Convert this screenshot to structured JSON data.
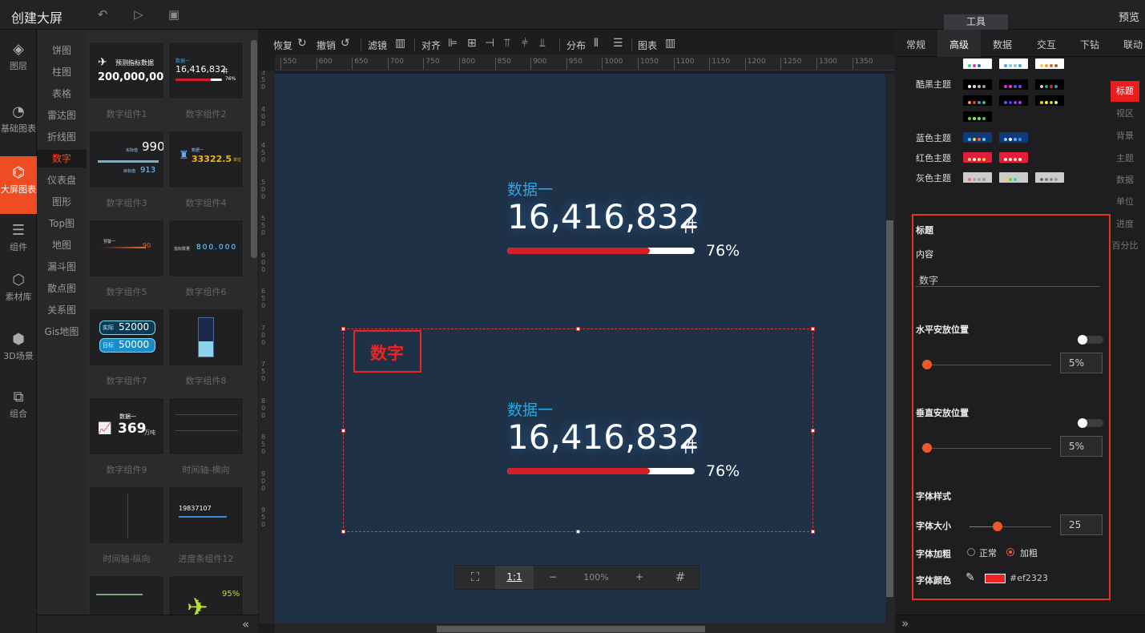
{
  "app": {
    "title": "创建大屏",
    "preview": "预览",
    "tools_tab": "工具"
  },
  "topbar_icons": [
    "undo-icon",
    "play-icon",
    "save-icon"
  ],
  "leftnav": [
    {
      "label": "图层",
      "icon": "layers-icon"
    },
    {
      "label": "基础图表",
      "icon": "pie-chart-icon"
    },
    {
      "label": "大屏图表",
      "icon": "monitor-chart-icon"
    },
    {
      "label": "组件",
      "icon": "sliders-icon"
    },
    {
      "label": "素材库",
      "icon": "hexagons-icon"
    },
    {
      "label": "3D场景",
      "icon": "cube-icon"
    },
    {
      "label": "组合",
      "icon": "group-icon"
    }
  ],
  "categories": [
    "饼图",
    "柱图",
    "表格",
    "雷达图",
    "折线图",
    "数字",
    "仪表盘",
    "图形",
    "Top图",
    "地图",
    "漏斗图",
    "散点图",
    "关系图",
    "Gis地图"
  ],
  "active_category": "数字",
  "components": [
    {
      "name": "数字组件1",
      "text1": "预测指标数据",
      "text2": "200,000,000"
    },
    {
      "name": "数字组件2",
      "text1": "数据一",
      "text2": "16,416,832",
      "text3": "件",
      "text4": "76%"
    },
    {
      "name": "数字组件3",
      "text1": "990",
      "text2": "913",
      "text3": "实际值",
      "text4": "目标值"
    },
    {
      "name": "数字组件4",
      "text1": "33322.5",
      "text2": "数据一",
      "text3": "单位"
    },
    {
      "name": "数字组件5",
      "text1": "90",
      "text2": "预警一"
    },
    {
      "name": "数字组件6",
      "text1": "800.000",
      "text2": "指标数量"
    },
    {
      "name": "数字组件7",
      "text1": "52000",
      "text2": "50000",
      "text3": "实际",
      "text4": "目标"
    },
    {
      "name": "数字组件8"
    },
    {
      "name": "数字组件9",
      "text1": "369",
      "text2": "万吨",
      "text3": "数据一"
    },
    {
      "name": "时间轴-横向"
    },
    {
      "name": "时间轴-纵向"
    },
    {
      "name": "进度条组件12",
      "text1": "19837107"
    },
    {
      "name": "",
      "text1": "95%"
    }
  ],
  "toolbar": {
    "redo": "恢复",
    "undo": "撤销",
    "filter": "滤镜",
    "align": "对齐",
    "distribute": "分布",
    "chart": "图表"
  },
  "ruler_h": [
    "550",
    "600",
    "650",
    "700",
    "750",
    "800",
    "850",
    "900",
    "950",
    "1000",
    "1050",
    "1100",
    "1150",
    "1200",
    "1250",
    "1300",
    "1350"
  ],
  "ruler_v": [
    "350",
    "400",
    "450",
    "500",
    "550",
    "600",
    "650",
    "700",
    "750",
    "800",
    "850",
    "900",
    "950"
  ],
  "widgets": [
    {
      "label": "数据一",
      "value": "16,416,832",
      "unit": "件",
      "percent": "76%",
      "fill": 0.76
    },
    {
      "label": "数据一",
      "value": "16,416,832",
      "unit": "件",
      "percent": "76%",
      "fill": 0.76
    }
  ],
  "selected_title": "数字",
  "zoom": {
    "ratio": "1:1",
    "minus": "−",
    "level": "100%",
    "plus": "+"
  },
  "right_tabs": [
    "常规",
    "高级",
    "数据",
    "交互",
    "下钻",
    "联动"
  ],
  "active_right_tab": "高级",
  "themes": {
    "cool": "酷黑主题",
    "blue": "蓝色主题",
    "red": "红色主题",
    "gray": "灰色主题"
  },
  "side_tabs": [
    "标题",
    "视区",
    "背景",
    "主题",
    "数据",
    "单位",
    "进度",
    "百分比"
  ],
  "props": {
    "section": "标题",
    "content_label": "内容",
    "content_value": "数字",
    "h_pos_label": "水平安放位置",
    "h_pos_value": "5%",
    "v_pos_label": "垂直安放位置",
    "v_pos_value": "5%",
    "font_style_label": "字体样式",
    "font_size_label": "字体大小",
    "font_size_value": "25",
    "font_weight_label": "字体加粗",
    "normal": "正常",
    "bold": "加粗",
    "font_color_label": "字体颜色",
    "font_color_value": "#ef2323"
  }
}
